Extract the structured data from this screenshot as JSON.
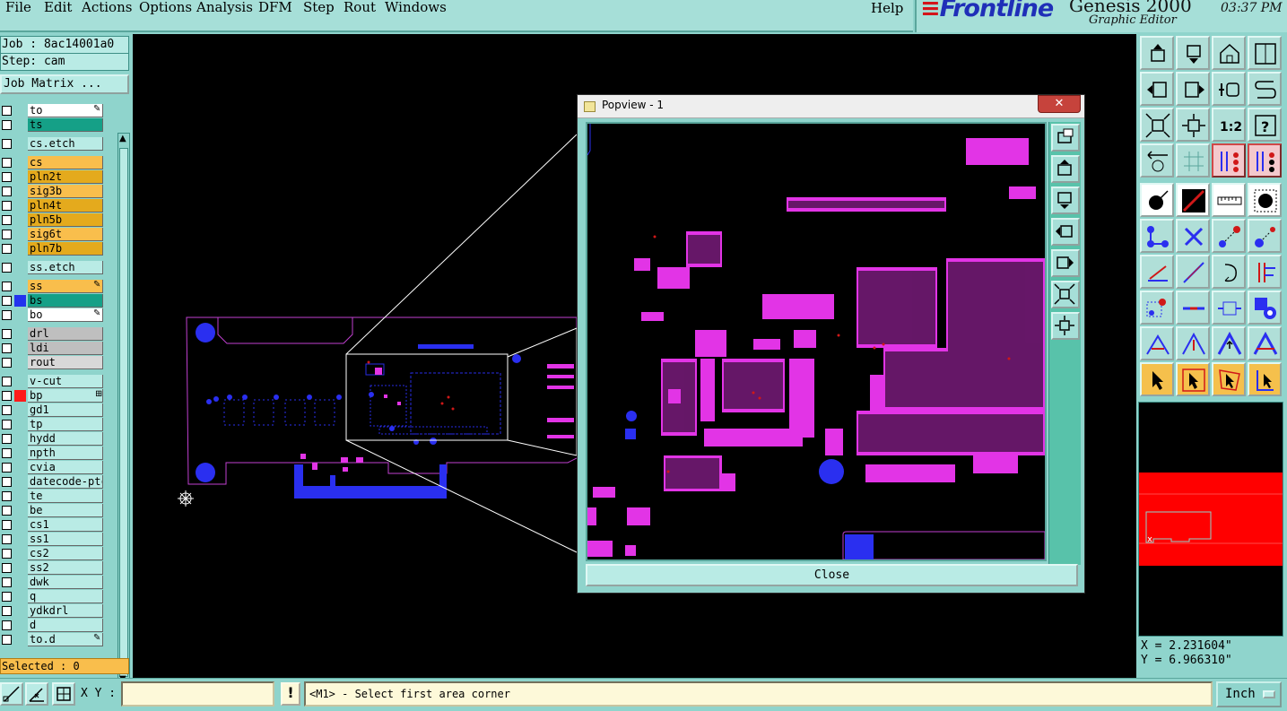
{
  "menubar": {
    "items": [
      "File",
      "Edit",
      "Actions",
      "Options",
      "Analysis",
      "DFM",
      "Step",
      "Rout",
      "Windows"
    ],
    "help": "Help"
  },
  "brand": {
    "logo": "Frontline",
    "product": "Genesis 2000",
    "subtitle": "Graphic Editor",
    "clock": "03:37 PM"
  },
  "job": {
    "job_line": "Job : 8ac14001a0",
    "step_line": "Step: cam",
    "matrix_button": "Job Matrix ..."
  },
  "layers": [
    {
      "name": "to",
      "color": "#ffffff",
      "mark": "pen",
      "swatch": ""
    },
    {
      "name": "ts",
      "color": "#15a087",
      "mark": "",
      "swatch": ""
    },
    {
      "name": "cs.etch",
      "color": "#b9ebe5",
      "mark": "",
      "swatch": ""
    },
    {
      "name": "cs",
      "color": "#f9be4c",
      "mark": "",
      "swatch": ""
    },
    {
      "name": "pln2t",
      "color": "#e4aa1d",
      "mark": "",
      "swatch": ""
    },
    {
      "name": "sig3b",
      "color": "#f9be4c",
      "mark": "",
      "swatch": ""
    },
    {
      "name": "pln4t",
      "color": "#e4aa1d",
      "mark": "",
      "swatch": ""
    },
    {
      "name": "pln5b",
      "color": "#e4aa1d",
      "mark": "",
      "swatch": ""
    },
    {
      "name": "sig6t",
      "color": "#f9be4c",
      "mark": "",
      "swatch": ""
    },
    {
      "name": "pln7b",
      "color": "#e4aa1d",
      "mark": "",
      "swatch": ""
    },
    {
      "name": "ss.etch",
      "color": "#b9ebe5",
      "mark": "",
      "swatch": ""
    },
    {
      "name": "ss",
      "color": "#f9be4c",
      "mark": "pen",
      "swatch": ""
    },
    {
      "name": "bs",
      "color": "#15a087",
      "mark": "",
      "swatch": "#2233ee"
    },
    {
      "name": "bo",
      "color": "#ffffff",
      "mark": "pen",
      "swatch": ""
    },
    {
      "name": "drl",
      "color": "#bfbfbf",
      "mark": "",
      "swatch": ""
    },
    {
      "name": "ldi",
      "color": "#bfbfbf",
      "mark": "",
      "swatch": ""
    },
    {
      "name": "rout",
      "color": "#d8d8d8",
      "mark": "",
      "swatch": ""
    },
    {
      "name": "v-cut",
      "color": "#b9ebe5",
      "mark": "",
      "swatch": ""
    },
    {
      "name": "bp",
      "color": "#b9ebe5",
      "mark": "grid",
      "swatch": "#ff1a1a"
    },
    {
      "name": "gd1",
      "color": "#b9ebe5",
      "mark": "",
      "swatch": ""
    },
    {
      "name": "tp",
      "color": "#b9ebe5",
      "mark": "",
      "swatch": ""
    },
    {
      "name": "hydd",
      "color": "#b9ebe5",
      "mark": "",
      "swatch": ""
    },
    {
      "name": "npth",
      "color": "#b9ebe5",
      "mark": "",
      "swatch": ""
    },
    {
      "name": "cvia",
      "color": "#b9ebe5",
      "mark": "",
      "swatch": ""
    },
    {
      "name": "datecode-ptc",
      "color": "#b9ebe5",
      "mark": "",
      "swatch": ""
    },
    {
      "name": "te",
      "color": "#b9ebe5",
      "mark": "",
      "swatch": ""
    },
    {
      "name": "be",
      "color": "#b9ebe5",
      "mark": "",
      "swatch": ""
    },
    {
      "name": "cs1",
      "color": "#b9ebe5",
      "mark": "",
      "swatch": ""
    },
    {
      "name": "ss1",
      "color": "#b9ebe5",
      "mark": "",
      "swatch": ""
    },
    {
      "name": "cs2",
      "color": "#b9ebe5",
      "mark": "",
      "swatch": ""
    },
    {
      "name": "ss2",
      "color": "#b9ebe5",
      "mark": "",
      "swatch": ""
    },
    {
      "name": "dwk",
      "color": "#b9ebe5",
      "mark": "",
      "swatch": ""
    },
    {
      "name": "q",
      "color": "#b9ebe5",
      "mark": "",
      "swatch": ""
    },
    {
      "name": "ydkdrl",
      "color": "#b9ebe5",
      "mark": "",
      "swatch": ""
    },
    {
      "name": "d",
      "color": "#b9ebe5",
      "mark": "",
      "swatch": ""
    },
    {
      "name": "to.d",
      "color": "#b9ebe5",
      "mark": "pen",
      "swatch": ""
    }
  ],
  "selected": "Selected : 0",
  "popview": {
    "title": "Popview - 1",
    "close_x": "✕",
    "close_button": "Close"
  },
  "coords": {
    "x": "X = 2.231604\"",
    "y": "Y = 6.966310\""
  },
  "statusbar": {
    "xy_label": "X Y :",
    "xy_value": "",
    "warn": "!",
    "prompt": "<M1> - Select first area corner",
    "units": "Inch"
  },
  "colors": {
    "pad_magenta": "#e234e6",
    "pad_blue": "#2a2ff0",
    "outline_magenta": "#c040d0",
    "panel_teal": "#8fd4cc"
  }
}
